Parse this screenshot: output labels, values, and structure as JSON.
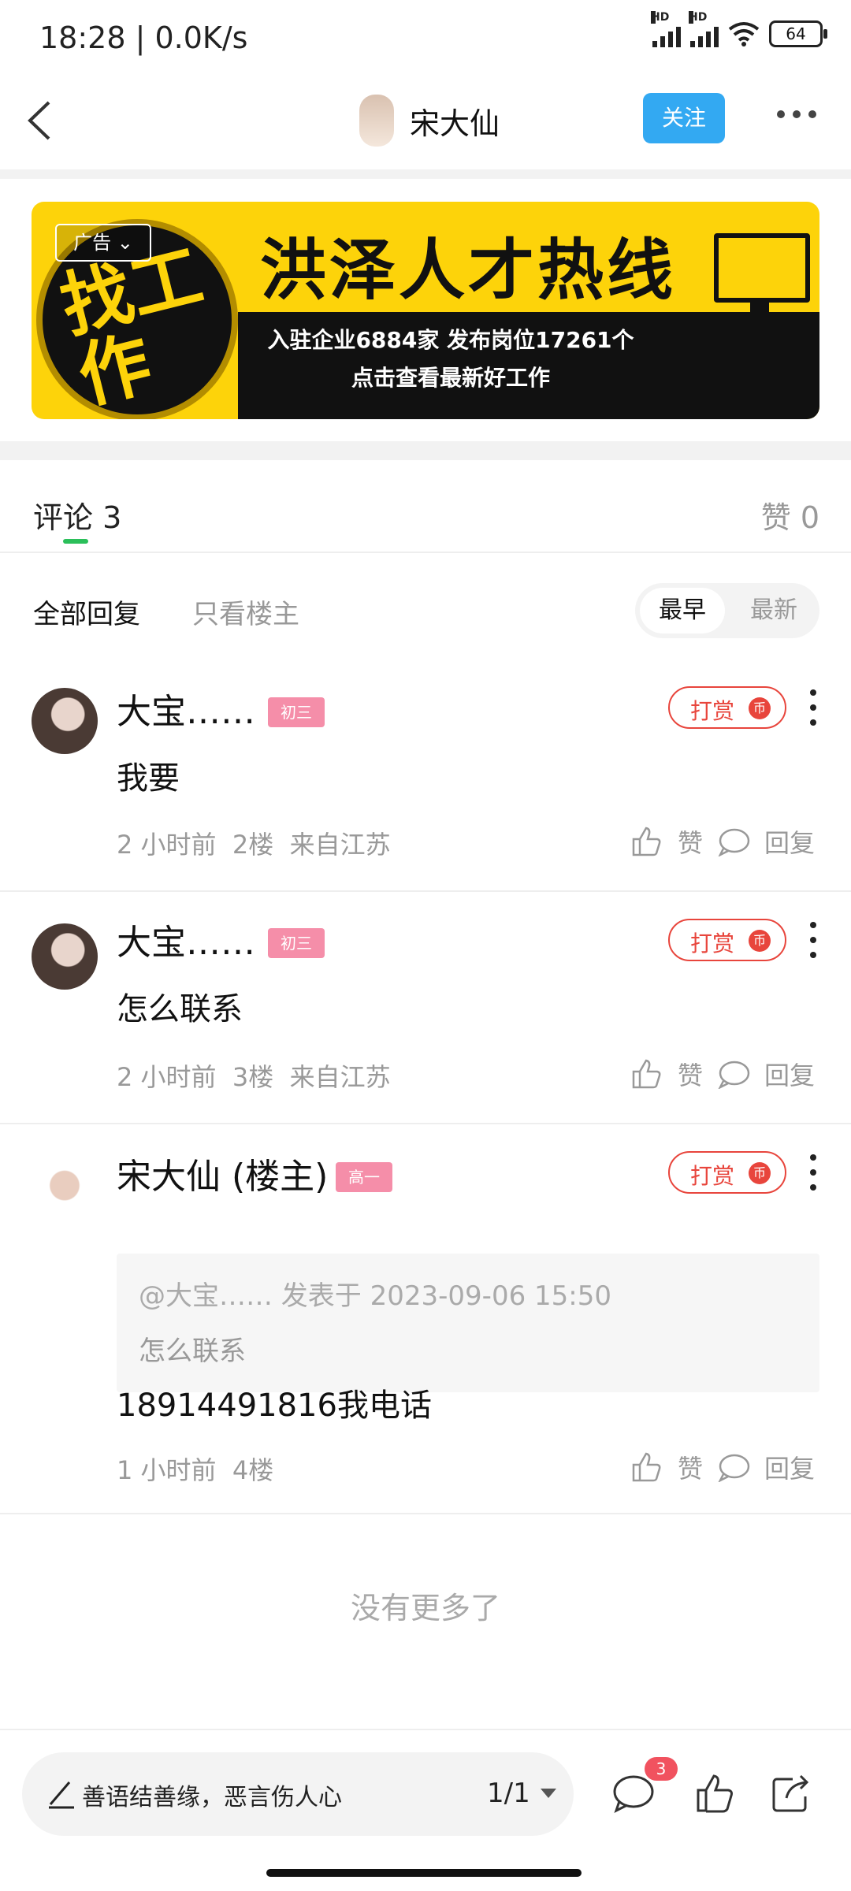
{
  "status_bar": {
    "time": "18:28 | 0.0K/s",
    "signal_label": "HD",
    "battery": "64"
  },
  "header": {
    "title": "宋大仙",
    "follow_label": "关注"
  },
  "ad": {
    "tag": "广告",
    "circle_text": "找工作",
    "title": "洪泽人才热线",
    "line1": "入驻企业6884家 发布岗位17261个",
    "line2": "点击查看最新好工作"
  },
  "tabs": {
    "comments_label": "评论",
    "comments_count": "3",
    "likes_label": "赞",
    "likes_count": "0"
  },
  "filters": {
    "all": "全部回复",
    "op_only": "只看楼主",
    "sort_earliest": "最早",
    "sort_latest": "最新"
  },
  "comments": [
    {
      "author": "大宝……",
      "level": "初三",
      "tip_label": "打赏",
      "content": "我要",
      "time": "2 小时前",
      "floor": "2楼",
      "location": "来自江苏",
      "like_label": "赞",
      "reply_label": "回复"
    },
    {
      "author": "大宝……",
      "level": "初三",
      "tip_label": "打赏",
      "content": "怎么联系",
      "time": "2 小时前",
      "floor": "3楼",
      "location": "来自江苏",
      "like_label": "赞",
      "reply_label": "回复"
    },
    {
      "author": "宋大仙 (楼主)",
      "level": "高一",
      "tip_label": "打赏",
      "quote_header": "@大宝…… 发表于 2023-09-06 15:50",
      "quote_text": "怎么联系",
      "content": "18914491816我电话",
      "time": "1 小时前",
      "floor": "4楼",
      "location": "",
      "like_label": "赞",
      "reply_label": "回复"
    }
  ],
  "no_more": "没有更多了",
  "bottom_bar": {
    "input_placeholder": "善语结善缘，恶言伤人心",
    "page": "1/1",
    "comment_badge": "3"
  }
}
